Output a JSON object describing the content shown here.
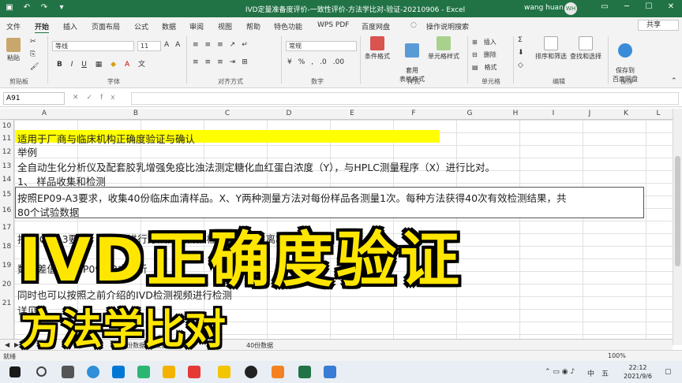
{
  "titlebar": {
    "title": "IVD定量准备度评价-一致性评价-方法学比对-验证-20210906  -  Excel",
    "user": "wang huan",
    "avatar": "WH",
    "qat": [
      "save-icon",
      "undo-icon",
      "redo-icon",
      "dropdown-icon"
    ],
    "window_buttons": [
      "─",
      "☐",
      "✕"
    ]
  },
  "tabs": {
    "items": [
      "文件",
      "开始",
      "插入",
      "页面布局",
      "公式",
      "数据",
      "审阅",
      "视图",
      "帮助",
      "特色功能",
      "WPS PDF",
      "百度网盘"
    ],
    "active": "开始",
    "tell_me": "操作说明搜索",
    "share": "共享"
  },
  "ribbon": {
    "paste": "粘贴",
    "clipboard": "剪贴板",
    "font_name": "等线",
    "font_size": "11",
    "font_group": "字体",
    "align_group": "对齐方式",
    "number_format": "常规",
    "number_group": "数字",
    "styles": [
      "条件格式",
      "套用\n表格格式",
      "单元格样式"
    ],
    "style_group": "样式",
    "cells": [
      "插入",
      "删除",
      "格式"
    ],
    "cell_group": "单元格",
    "editing": [
      "排序和筛选",
      "查找和选择"
    ],
    "edit_group": "编辑",
    "save_to": "保存到\n百度网盘",
    "save_group": "保存"
  },
  "formula_bar": {
    "name_box": "A91",
    "fx": "fx",
    "formula": ""
  },
  "grid": {
    "columns": [
      "A",
      "B",
      "C",
      "D",
      "E",
      "F",
      "G",
      "H",
      "I",
      "J",
      "K",
      "L"
    ],
    "rows": [
      "10",
      "11",
      "12",
      "13",
      "14",
      "15",
      "16",
      "17",
      "18",
      "19",
      "20",
      "21"
    ],
    "row11": "适用于厂商与临床机构正确度验证与确认",
    "row12": "举例",
    "row13": "全自动生化分析仪及配套胶乳增强免疫比浊法测定糖化血红蛋白浓度（Y），与HPLC测量程序（X）进行比对。",
    "row14": "1、 样品收集和检测",
    "row15": "按照EP09-A3要求，收集40份临床血清样品。X、Y两种测量方法对每份样品各测量1次。每种方法获得40次有效检测结果，共",
    "row16": "80个试验数据",
    "row18": "按EP09-A3要求，对数据进行方法内离群点检验，未发现离群值",
    "row20": "数据差值使用EP09-A3中分析",
    "row22": "同时也可以按照之前介绍的IVD检测视频进行检测",
    "row23": "详见图"
  },
  "sheet_tabs": [
    "40份数据",
    "数值",
    "40份数据"
  ],
  "status": {
    "ready": "就绪",
    "zoom": "100%"
  },
  "taskbar": {
    "time": "22:12",
    "date": "2021/9/6",
    "ime": [
      "中",
      "五"
    ]
  },
  "overlay": {
    "title": "IVD正确度验证",
    "subtitle": "方法学比对"
  },
  "colors": {
    "excel_green": "#217346",
    "highlight": "#ffff00",
    "overlay_yellow": "#ffe600"
  }
}
